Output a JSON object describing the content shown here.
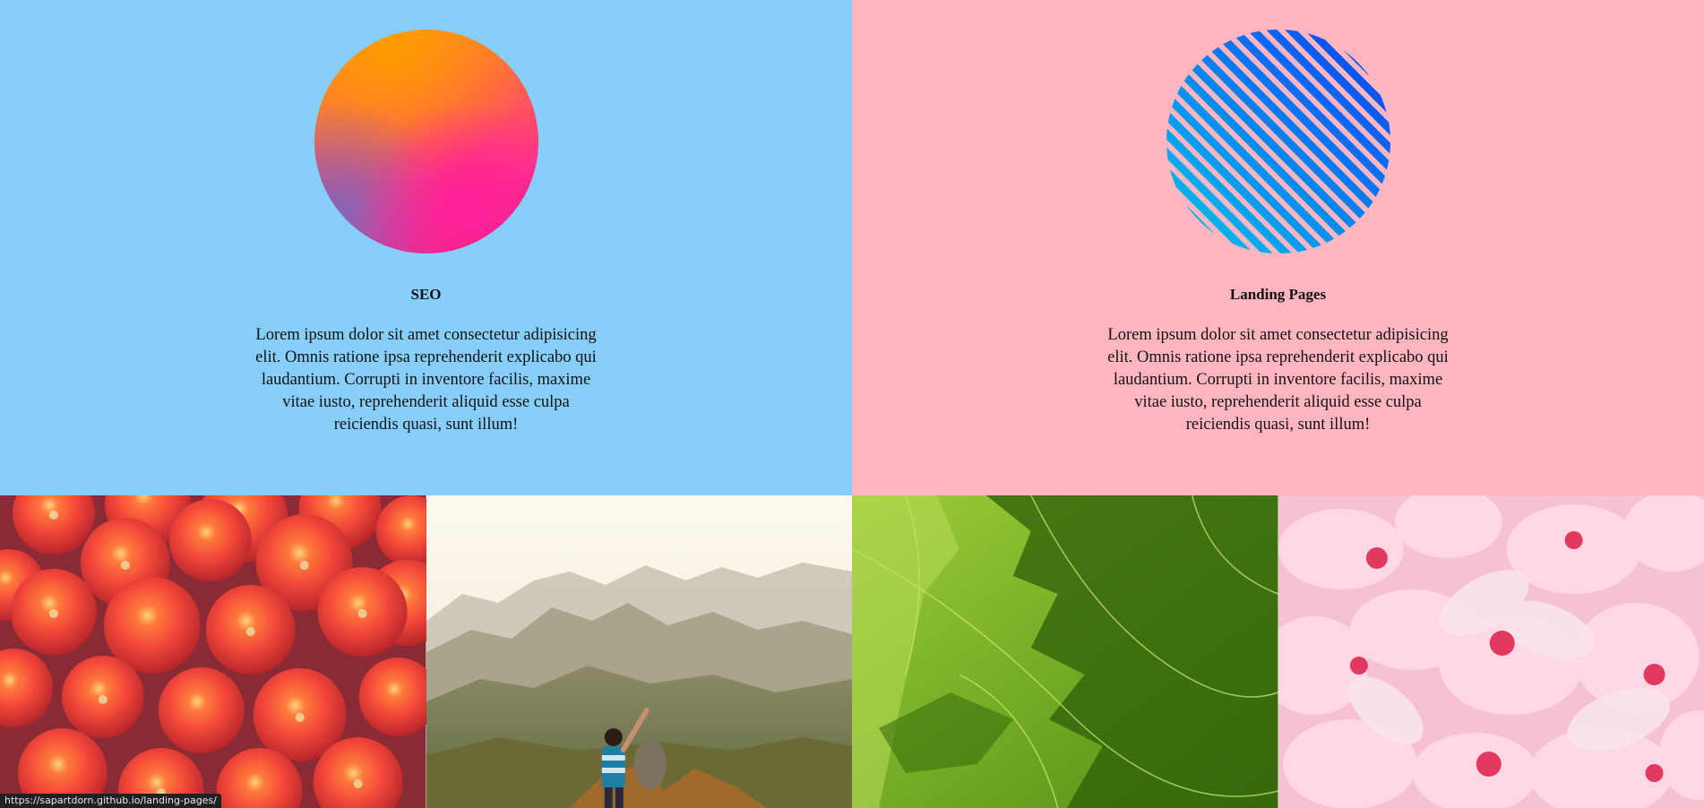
{
  "services": [
    {
      "title": "SEO",
      "description": "Lorem ipsum dolor sit amet consectetur adipisicing elit. Omnis ratione ipsa reprehenderit explicabo qui laudantium. Corrupti in inventore facilis, maxime vitae iusto, reprehenderit aliquid esse culpa reiciendis quasi, sunt illum!",
      "background_color": "#87cefa",
      "icon": "gradient-orb"
    },
    {
      "title": "Landing Pages",
      "description": "Lorem ipsum dolor sit amet consectetur adipisicing elit. Omnis ratione ipsa reprehenderit explicabo qui laudantium. Corrupti in inventore facilis, maxime vitae iusto, reprehenderit aliquid esse culpa reiciendis quasi, sunt illum!",
      "background_color": "#ffb6c1",
      "icon": "striped-orb"
    }
  ],
  "gallery": [
    {
      "subject": "tomatoes"
    },
    {
      "subject": "mountain-hiker"
    },
    {
      "subject": "green-leaves"
    },
    {
      "subject": "pink-blossoms"
    }
  ],
  "status_bar": {
    "url": "https://sapartdorn.github.io/landing-pages/"
  }
}
